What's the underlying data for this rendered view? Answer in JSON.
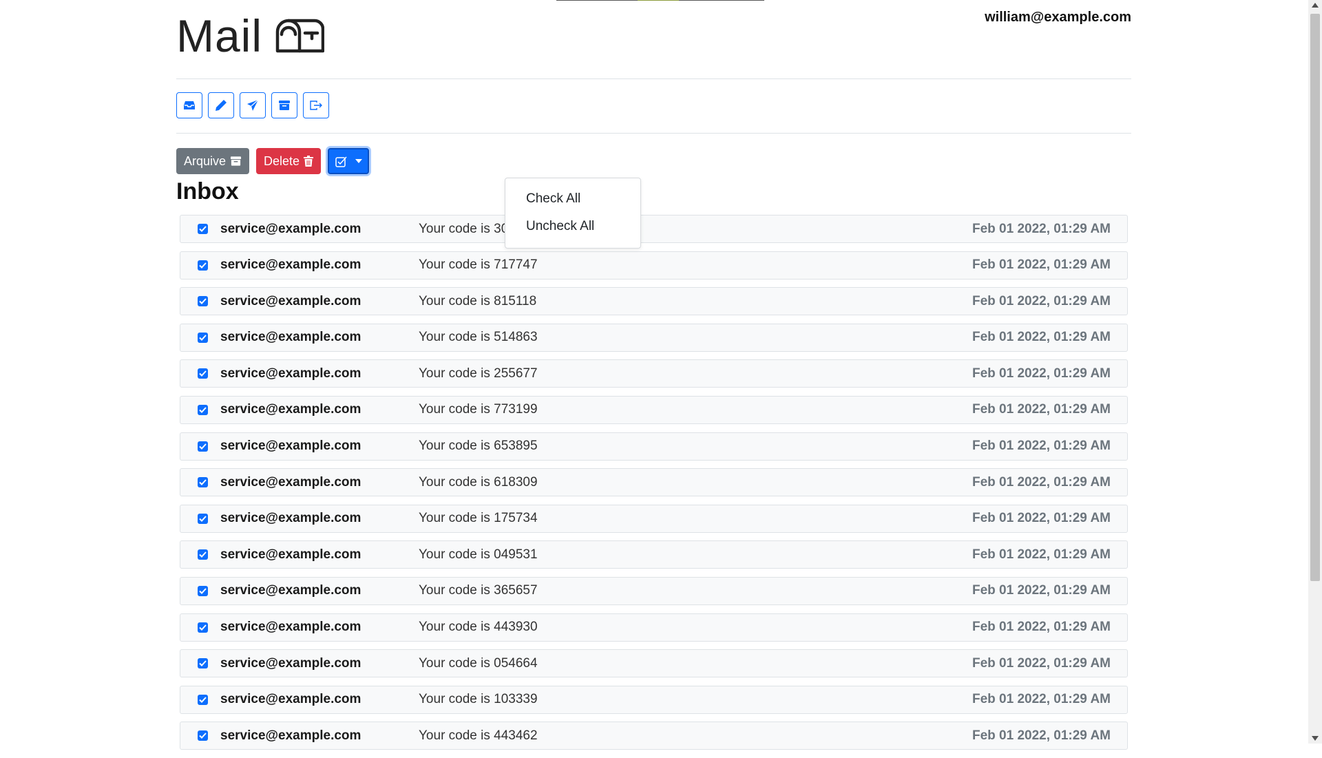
{
  "header": {
    "app_title": "Mail",
    "user_email": "william@example.com"
  },
  "nav": {
    "buttons": [
      {
        "name": "inbox",
        "icon": "inbox-icon"
      },
      {
        "name": "compose",
        "icon": "pencil-icon"
      },
      {
        "name": "sent",
        "icon": "send-icon"
      },
      {
        "name": "archived",
        "icon": "archive-icon"
      },
      {
        "name": "logout",
        "icon": "logout-icon"
      }
    ]
  },
  "actions": {
    "archive_label": "Arquive",
    "delete_label": "Delete"
  },
  "dropdown": {
    "check_all": "Check All",
    "uncheck_all": "Uncheck All"
  },
  "mailbox": {
    "title": "Inbox",
    "emails": [
      {
        "sender": "service@example.com",
        "subject": "Your code is 300714",
        "date": "Feb 01 2022, 01:29 AM",
        "checked": true
      },
      {
        "sender": "service@example.com",
        "subject": "Your code is 717747",
        "date": "Feb 01 2022, 01:29 AM",
        "checked": true
      },
      {
        "sender": "service@example.com",
        "subject": "Your code is 815118",
        "date": "Feb 01 2022, 01:29 AM",
        "checked": true
      },
      {
        "sender": "service@example.com",
        "subject": "Your code is 514863",
        "date": "Feb 01 2022, 01:29 AM",
        "checked": true
      },
      {
        "sender": "service@example.com",
        "subject": "Your code is 255677",
        "date": "Feb 01 2022, 01:29 AM",
        "checked": true
      },
      {
        "sender": "service@example.com",
        "subject": "Your code is 773199",
        "date": "Feb 01 2022, 01:29 AM",
        "checked": true
      },
      {
        "sender": "service@example.com",
        "subject": "Your code is 653895",
        "date": "Feb 01 2022, 01:29 AM",
        "checked": true
      },
      {
        "sender": "service@example.com",
        "subject": "Your code is 618309",
        "date": "Feb 01 2022, 01:29 AM",
        "checked": true
      },
      {
        "sender": "service@example.com",
        "subject": "Your code is 175734",
        "date": "Feb 01 2022, 01:29 AM",
        "checked": true
      },
      {
        "sender": "service@example.com",
        "subject": "Your code is 049531",
        "date": "Feb 01 2022, 01:29 AM",
        "checked": true
      },
      {
        "sender": "service@example.com",
        "subject": "Your code is 365657",
        "date": "Feb 01 2022, 01:29 AM",
        "checked": true
      },
      {
        "sender": "service@example.com",
        "subject": "Your code is 443930",
        "date": "Feb 01 2022, 01:29 AM",
        "checked": true
      },
      {
        "sender": "service@example.com",
        "subject": "Your code is 054664",
        "date": "Feb 01 2022, 01:29 AM",
        "checked": true
      },
      {
        "sender": "service@example.com",
        "subject": "Your code is 103339",
        "date": "Feb 01 2022, 01:29 AM",
        "checked": true
      },
      {
        "sender": "service@example.com",
        "subject": "Your code is 443462",
        "date": "Feb 01 2022, 01:29 AM",
        "checked": true
      }
    ]
  },
  "colors": {
    "primary": "#0d6efd",
    "secondary": "#6c757d",
    "danger": "#dc3545"
  }
}
